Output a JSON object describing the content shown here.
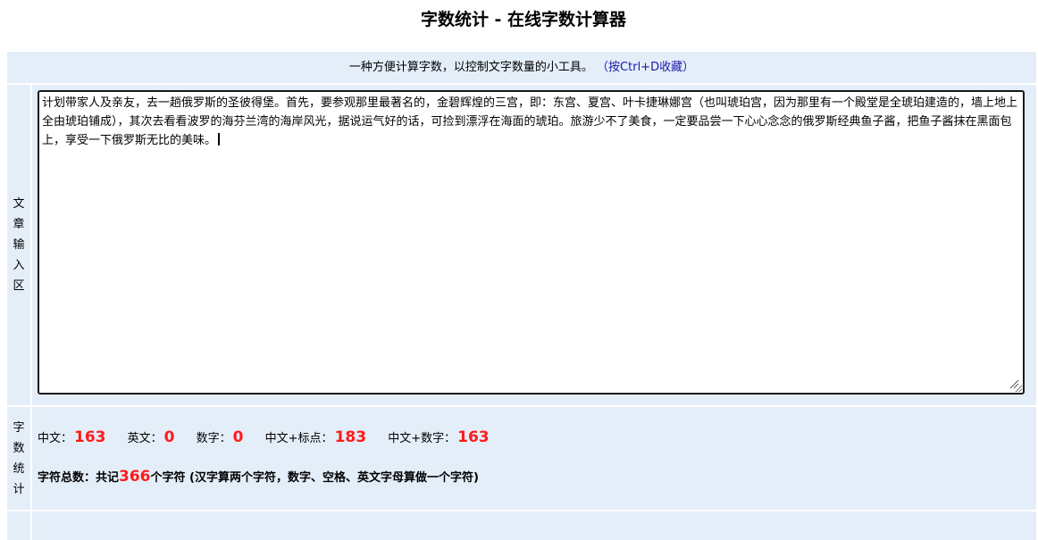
{
  "page": {
    "title": "字数统计 - 在线字数计算器"
  },
  "subtitle": {
    "text": "一种方便计算字数，以控制文字数量的小工具。",
    "hint": "（按Ctrl+D收藏）"
  },
  "input": {
    "label": "文章输入区",
    "value": "计划带家人及亲友，去一趟俄罗斯的圣彼得堡。首先，要参观那里最著名的，金碧辉煌的三宫，即：东宫、夏宫、叶卡捷琳娜宫（也叫琥珀宫，因为那里有一个殿堂是全琥珀建造的，墙上地上全由琥珀铺成），其次去看看波罗的海芬兰湾的海岸风光，据说运气好的话，可捡到漂浮在海面的琥珀。旅游少不了美食，一定要品尝一下心心念念的俄罗斯经典鱼子酱，把鱼子酱抹在黑面包上，享受一下俄罗斯无比的美味。"
  },
  "stats": {
    "label": "字数统计",
    "chinese_label": "中文：",
    "chinese": "163",
    "english_label": "英文：",
    "english": "0",
    "digits_label": "数字：",
    "digits": "0",
    "chinese_punct_label": "中文+标点：",
    "chinese_punct": "183",
    "chinese_digits_label": "中文+数字：",
    "chinese_digits": "163",
    "total_prefix": "字符总数：共记",
    "total": "366",
    "total_suffix": "个字符 (汉字算两个字符，数字、空格、英文字母算做一个字符)"
  },
  "colors": {
    "panel_bg": "#e4eef9",
    "value_red": "#ff1a1a",
    "hint_blue": "#1a1aa8"
  }
}
